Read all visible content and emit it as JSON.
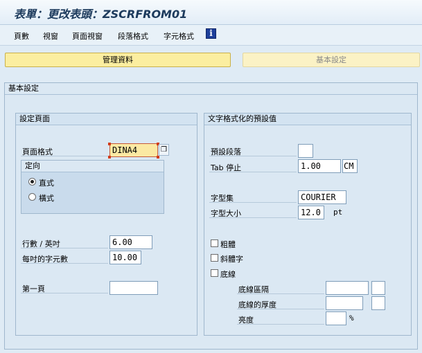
{
  "window": {
    "title": "表單：更改表頭：ZSCRFROM01"
  },
  "menu": {
    "items": [
      "頁數",
      "視窗",
      "頁面視窗",
      "段落格式",
      "字元格式"
    ],
    "info_icon": "i"
  },
  "tabs": {
    "active": "管理資料",
    "inactive": "基本設定"
  },
  "basic_settings": {
    "title": "基本設定",
    "page_setup": {
      "title": "設定頁面",
      "page_format_label": "頁面格式",
      "page_format_value": "DINA4",
      "orientation": {
        "title": "定向",
        "portrait": "直式",
        "landscape": "橫式",
        "selected": "portrait"
      },
      "lines_per_inch_label": "行數 / 英吋",
      "lines_per_inch_value": "6.00",
      "chars_per_inch_label": "每吋的字元數",
      "chars_per_inch_value": "10.00",
      "first_page_label": "第一頁",
      "first_page_value": ""
    },
    "text_format_defaults": {
      "title": "文字格式化的預設值",
      "default_paragraph_label": "預設段落",
      "default_paragraph_value": "",
      "tab_stop_label": "Tab 停止",
      "tab_stop_value": "1.00",
      "tab_stop_unit": "CM",
      "font_family_label": "字型集",
      "font_family_value": "COURIER",
      "font_size_label": "字型大小",
      "font_size_value": "12.0",
      "font_size_unit": "pt",
      "bold_label": "粗體",
      "italic_label": "斜體字",
      "underline_label": "底線",
      "underline_spacing_label": "底線區隔",
      "underline_thickness_label": "底線的厚度",
      "brightness_label": "亮度",
      "brightness_unit": "%"
    }
  }
}
